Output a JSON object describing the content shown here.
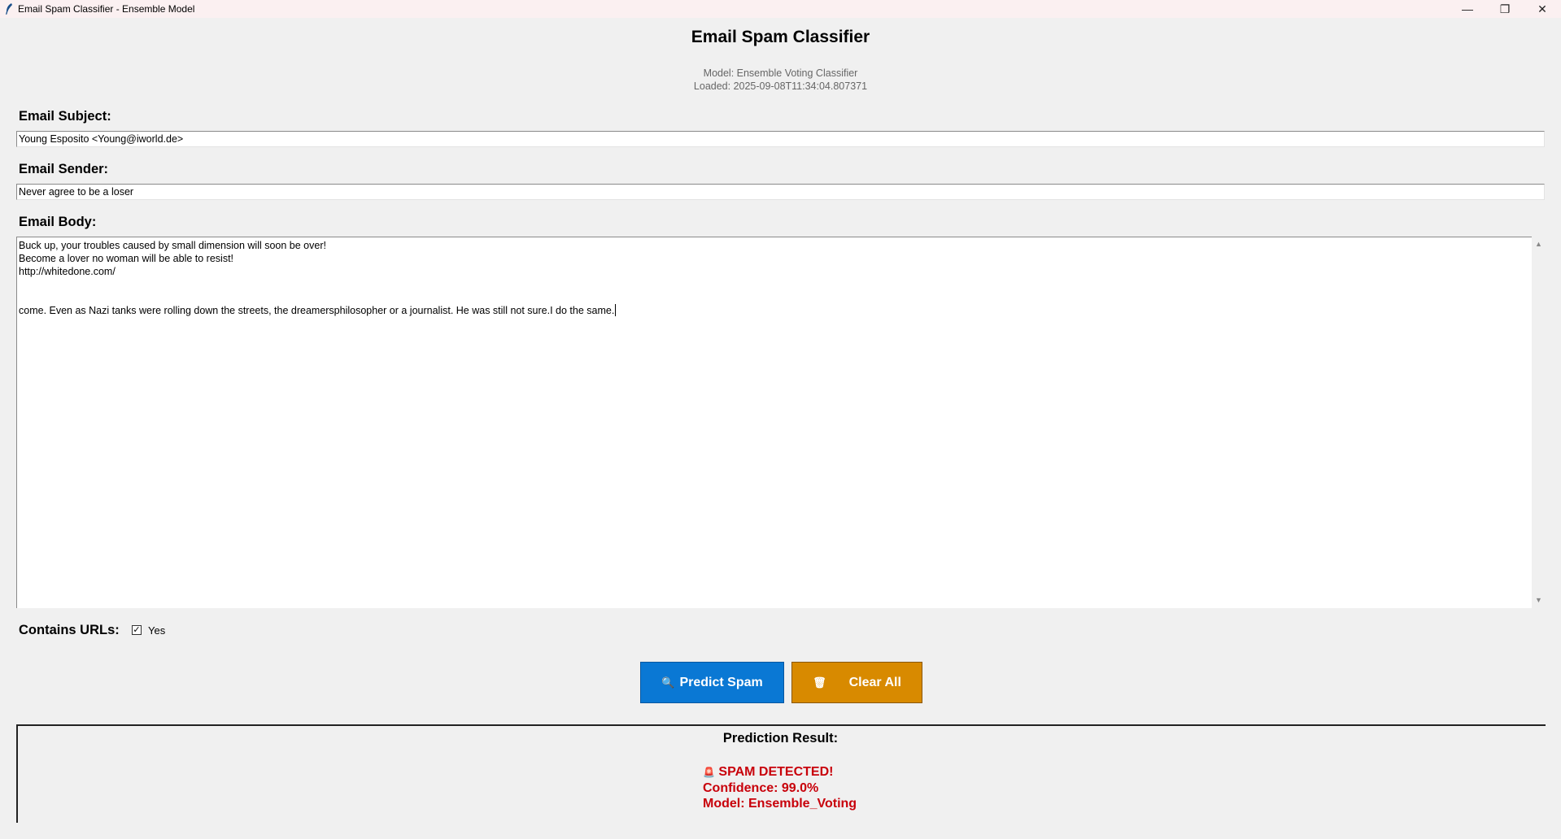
{
  "window": {
    "title": "Email Spam Classifier - Ensemble Model",
    "minimize_glyph": "—",
    "restore_glyph": "❐",
    "close_glyph": "✕",
    "app_icon": "feather-icon"
  },
  "header": {
    "title": "Email Spam Classifier",
    "model_line": "Model: Ensemble Voting Classifier",
    "loaded_line": "Loaded: 2025-09-08T11:34:04.807371"
  },
  "form": {
    "subject_label": "Email Subject:",
    "subject_value": "Young Esposito <Young@iworld.de>",
    "sender_label": "Email Sender:",
    "sender_value": "Never agree to be a loser",
    "body_label": "Email Body:",
    "body_value": "Buck up, your troubles caused by small dimension will soon be over!\nBecome a lover no woman will be able to resist!\nhttp://whitedone.com/\n\n\ncome. Even as Nazi tanks were rolling down the streets, the dreamersphilosopher or a journalist. He was still not sure.I do the same.",
    "urls_label": "Contains URLs:",
    "urls_checked": true,
    "urls_option_label": "Yes"
  },
  "buttons": {
    "predict_label": "Predict Spam",
    "predict_icon": "🔍",
    "clear_label": "Clear All",
    "clear_icon": "🗑"
  },
  "result": {
    "title": "Prediction Result:",
    "icon": "🚨",
    "status": "SPAM DETECTED!",
    "confidence": "Confidence: 99.0%",
    "model": "Model: Ensemble_Voting",
    "color": "#c8000a"
  },
  "colors": {
    "predict_button": "#0a78d4",
    "clear_button": "#d88a00"
  }
}
